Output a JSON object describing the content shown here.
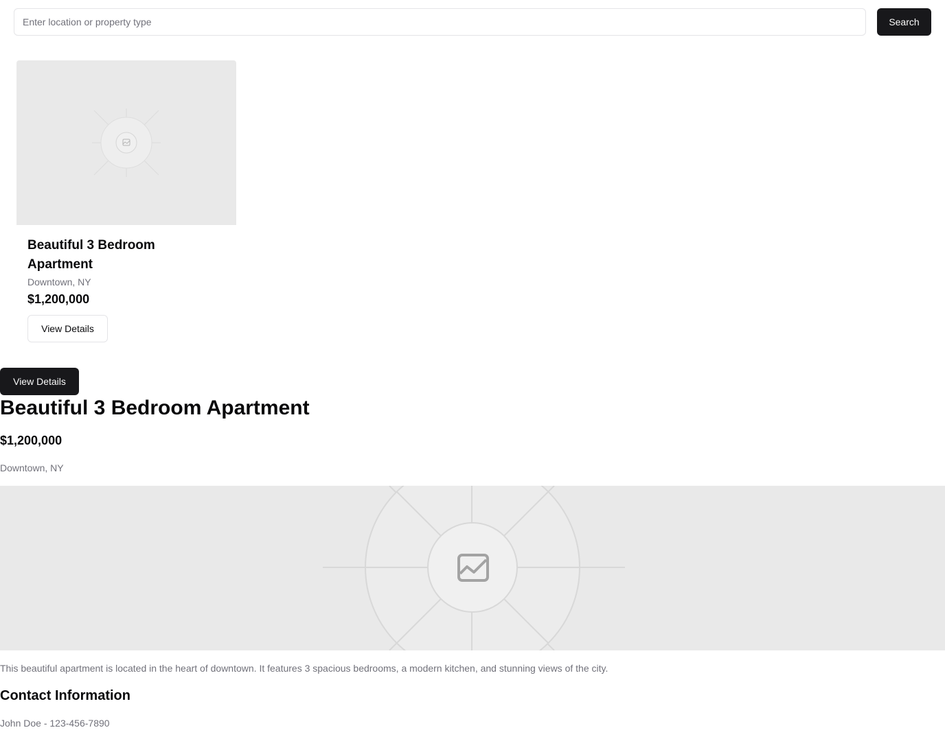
{
  "search": {
    "placeholder": "Enter location or property type",
    "value": "",
    "button_label": "Search"
  },
  "card": {
    "image_icon": "image-icon",
    "title": "Beautiful 3 Bedroom Apartment",
    "location": "Downtown, NY",
    "price": "$1,200,000",
    "button_label": "View Details"
  },
  "detail": {
    "button_label": "View Details",
    "title": "Beautiful 3 Bedroom Apartment",
    "price": "$1,200,000",
    "location": "Downtown, NY",
    "image_icon": "image-icon",
    "description": "This beautiful apartment is located in the heart of downtown. It features 3 spacious bedrooms, a modern kitchen, and stunning views of the city.",
    "contact_heading": "Contact Information",
    "contact_line": "John Doe - 123-456-7890"
  },
  "colors": {
    "primary": "#18181b",
    "muted_text": "#71717a",
    "border": "#e4e4e7",
    "placeholder_bg": "#e9e9e9"
  }
}
